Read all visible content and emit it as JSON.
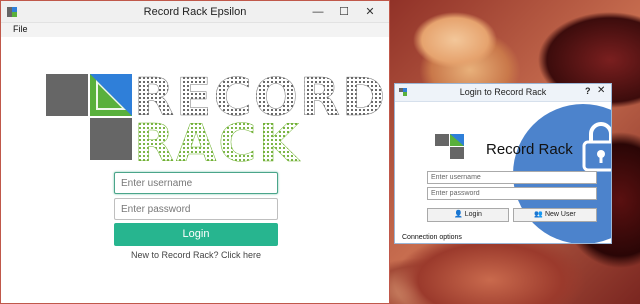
{
  "main_window": {
    "title": "Record Rack Epsilon",
    "minimize": "—",
    "maximize": "☐",
    "close": "✕",
    "menu": {
      "file": "File"
    },
    "logo": {
      "line1": "RECORD",
      "line2": "RACK"
    },
    "username_placeholder": "Enter username",
    "password_placeholder": "Enter password",
    "login_label": "Login",
    "new_link": "New to Record Rack? Click here"
  },
  "login_dialog": {
    "title": "Login to Record Rack",
    "help": "?",
    "close": "✕",
    "brand": "Record Rack",
    "username_placeholder": "Enter username",
    "password_placeholder": "Enter password",
    "login_label": "Login",
    "new_user_label": "New User",
    "connection_options": "Connection options"
  },
  "colors": {
    "accent_teal": "#27b58f",
    "logo_blue": "#2f7fd9",
    "logo_green": "#59b03c",
    "lock_circle": "#3d78c8"
  },
  "icons": [
    "app-icon",
    "lock-icon",
    "user-icon",
    "add-user-icon"
  ]
}
